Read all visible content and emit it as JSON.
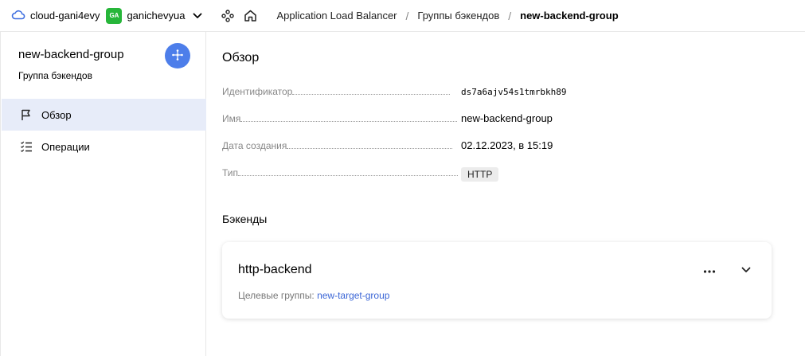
{
  "header": {
    "cloud_name": "cloud-gani4evy",
    "user_initials": "GA",
    "user_name": "ganichevyua",
    "breadcrumbs": [
      "Application Load Balancer",
      "Группы бэкендов",
      "new-backend-group"
    ],
    "separator": "/"
  },
  "sidebar": {
    "title": "new-backend-group",
    "subtitle": "Группа бэкендов",
    "items": [
      {
        "label": "Обзор",
        "icon": "flag-icon",
        "active": true
      },
      {
        "label": "Операции",
        "icon": "list-icon",
        "active": false
      }
    ]
  },
  "overview": {
    "title": "Обзор",
    "fields": [
      {
        "key": "Идентификатор",
        "value": "ds7a6ajv54s1tmrbkh89"
      },
      {
        "key": "Имя",
        "value": "new-backend-group"
      },
      {
        "key": "Дата создания",
        "value": "02.12.2023, в 15:19"
      },
      {
        "key": "Тип",
        "value": "HTTP"
      }
    ]
  },
  "backends": {
    "title": "Бэкенды",
    "items": [
      {
        "name": "http-backend",
        "target_groups_label": "Целевые группы:",
        "target_group": "new-target-group"
      }
    ]
  },
  "colors": {
    "accent": "#4d7eea",
    "badge": "#27b63a",
    "active_bg": "#e7ecf9",
    "link": "#3b66d6"
  }
}
